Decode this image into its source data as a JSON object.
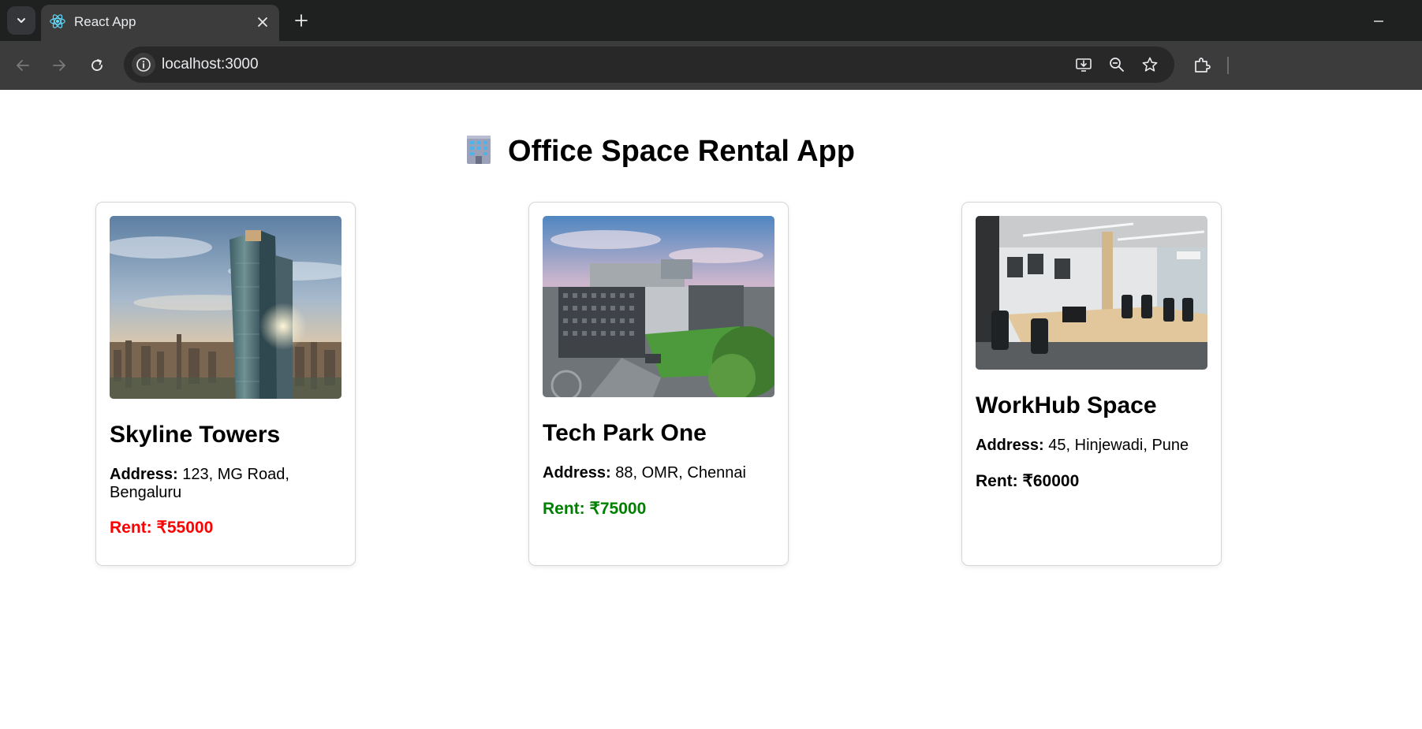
{
  "browser": {
    "tab_title": "React App",
    "url": "localhost:3000"
  },
  "page": {
    "heading": "Office Space Rental App",
    "heading_icon": "office-building-emoji"
  },
  "listings": [
    {
      "name": "Skyline Towers",
      "address_label": "Address:",
      "address": "123, MG Road, Bengaluru",
      "rent_label": "Rent:",
      "rent": "₹55000",
      "rent_color": "#ff0000",
      "image": "skyscraper-city-photo"
    },
    {
      "name": "Tech Park One",
      "address_label": "Address:",
      "address": "88, OMR, Chennai",
      "rent_label": "Rent:",
      "rent": "₹75000",
      "rent_color": "#008000",
      "image": "office-campus-aerial-photo"
    },
    {
      "name": "WorkHub Space",
      "address_label": "Address:",
      "address": "45, Hinjewadi, Pune",
      "rent_label": "Rent:",
      "rent": "₹60000",
      "rent_color": "#000000",
      "image": "coworking-interior-photo"
    }
  ],
  "colors": {
    "tabstrip_bg": "#1f2020",
    "toolbar_bg": "#3c3c3c",
    "omnibox_bg": "#282828"
  }
}
